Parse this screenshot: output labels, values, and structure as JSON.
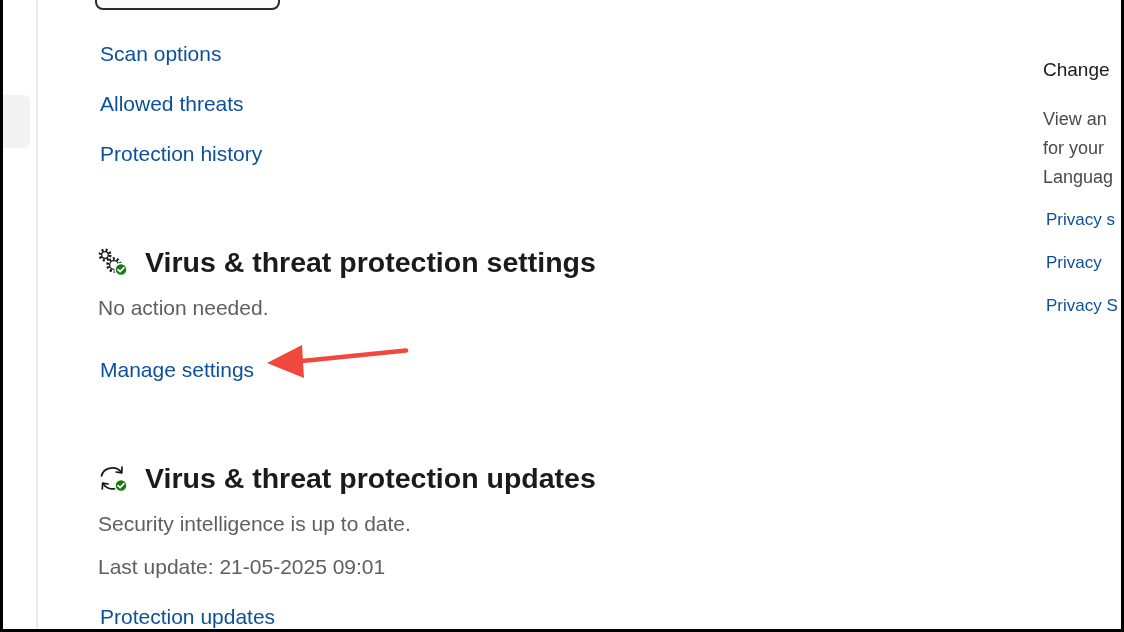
{
  "sidebar": {
    "items": [
      {
        "selected": true
      }
    ]
  },
  "links": [
    "Scan options",
    "Allowed threats",
    "Protection history"
  ],
  "sections": [
    {
      "kind": "settings",
      "title": "Virus & threat protection settings",
      "lines": [
        "No action needed."
      ],
      "links": [
        "Manage settings"
      ]
    },
    {
      "kind": "updates",
      "title": "Virus & threat protection updates",
      "lines": [
        "Security intelligence is up to date.",
        "Last update: 21-05-2025 09:01"
      ],
      "links": [
        "Protection updates"
      ]
    }
  ],
  "annotations": [
    {
      "kind": "arrow"
    }
  ],
  "right_panel": {
    "title": "Change",
    "description": [
      "View an",
      "for your",
      "Languag"
    ],
    "links": [
      "Privacy s",
      "Privacy",
      "Privacy S"
    ]
  }
}
